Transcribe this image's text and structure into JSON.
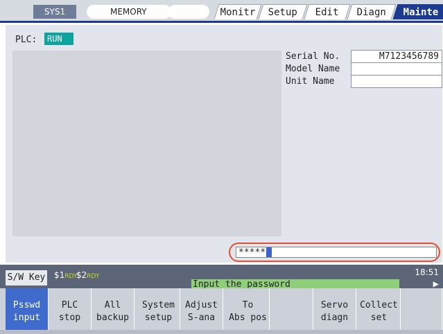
{
  "header": {
    "sys_label": "SYS1",
    "mode_label": "MEMORY",
    "tabs": [
      {
        "label": "Monitr",
        "active": false
      },
      {
        "label": "Setup",
        "active": false
      },
      {
        "label": "Edit",
        "active": false
      },
      {
        "label": "Diagn",
        "active": false
      },
      {
        "label": "Mainte",
        "active": true
      }
    ]
  },
  "main": {
    "plc_label": "PLC:",
    "plc_status": "RUN",
    "info": [
      {
        "label": "Serial No.",
        "value": "M7123456789"
      },
      {
        "label": "Model Name",
        "value": ""
      },
      {
        "label": "Unit Name",
        "value": ""
      }
    ],
    "password_value": "*****"
  },
  "status_bar": {
    "swkey_label": "S/W Key",
    "ch1": "$1",
    "ch1_state": "RDY",
    "ch2": "$2",
    "ch2_state": "RDY",
    "time": "18:51",
    "message": "Input the password",
    "next_icon": "next-page-arrow-icon"
  },
  "softkeys": [
    {
      "line1": "Psswd",
      "line2": "input",
      "active": true
    },
    {
      "line1": "PLC",
      "line2": "stop",
      "active": false
    },
    {
      "line1": "All",
      "line2": "backup",
      "active": false
    },
    {
      "line1": "System",
      "line2": "setup",
      "active": false
    },
    {
      "line1": "Adjust",
      "line2": "S-ana",
      "active": false
    },
    {
      "line1": "To",
      "line2": "Abs pos",
      "active": false
    },
    {
      "line1": "",
      "line2": "",
      "active": false
    },
    {
      "line1": "Servo",
      "line2": "diagn",
      "active": false
    },
    {
      "line1": "Collect",
      "line2": "set",
      "active": false
    },
    {
      "line1": "",
      "line2": "",
      "active": false
    }
  ],
  "colors": {
    "accent": "#1c3b8f",
    "active_key": "#3f6ccc",
    "plc_run": "#0fa3a0",
    "message_bg": "#8fcf7a",
    "highlight_ring": "#e0502e"
  }
}
